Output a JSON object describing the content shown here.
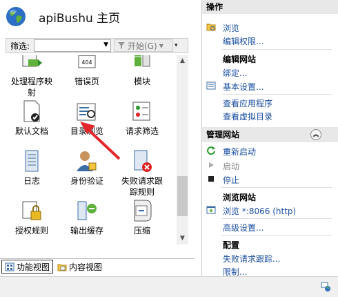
{
  "header": {
    "title": "apiBushu 主页"
  },
  "filter": {
    "label": "筛选:",
    "value": "",
    "start_label": "开始(G)"
  },
  "features": [
    {
      "label": "处理程序映\n射",
      "icon": "handler-mappings-icon"
    },
    {
      "label": "错误页",
      "icon": "error-pages-icon",
      "badge": "404"
    },
    {
      "label": "模块",
      "icon": "modules-icon"
    },
    {
      "label": "默认文档",
      "icon": "default-document-icon"
    },
    {
      "label": "目录浏览",
      "icon": "directory-browsing-icon"
    },
    {
      "label": "请求筛选",
      "icon": "request-filtering-icon"
    },
    {
      "label": "日志",
      "icon": "logging-icon"
    },
    {
      "label": "身份验证",
      "icon": "authentication-icon"
    },
    {
      "label": "失败请求跟\n踪规则",
      "icon": "failed-request-tracing-icon"
    },
    {
      "label": "授权规则",
      "icon": "authorization-rules-icon"
    },
    {
      "label": "输出缓存",
      "icon": "output-caching-icon"
    },
    {
      "label": "压缩",
      "icon": "compression-icon"
    }
  ],
  "view_tabs": {
    "features": "功能视图",
    "content": "内容视图"
  },
  "actions": {
    "title": "操作",
    "explore": "浏览",
    "edit_permissions": "编辑权限...",
    "edit_site_heading": "编辑网站",
    "bindings": "绑定...",
    "basic_settings": "基本设置...",
    "view_apps": "查看应用程序",
    "view_vdirs": "查看虚拟目录",
    "manage_site": "管理网站",
    "restart": "重新启动",
    "start": "启动",
    "stop": "停止",
    "browse_site_heading": "浏览网站",
    "browse_http": "浏览 *:8066 (http)",
    "advanced_settings": "高级设置...",
    "config_heading": "配置",
    "failed_request_tracing": "失败请求跟踪...",
    "limits": "限制..."
  },
  "colors": {
    "link": "#1c4fa0",
    "annotation_arrow": "#e3262b"
  }
}
